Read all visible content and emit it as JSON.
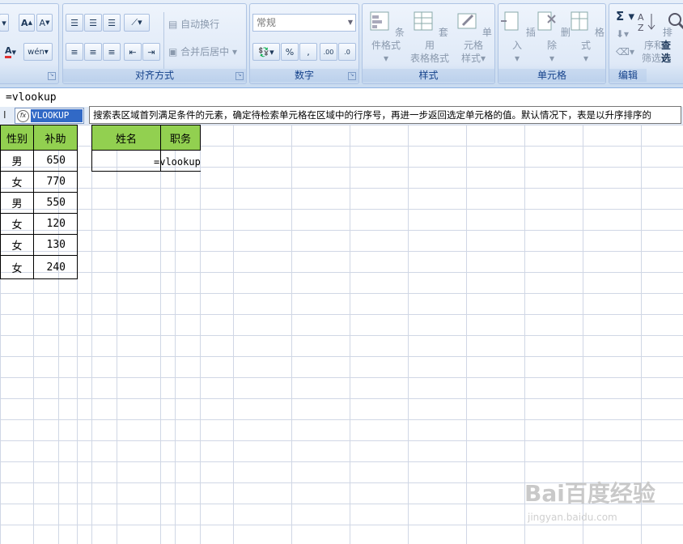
{
  "ribbon": {
    "groups": {
      "alignment": "对齐方式",
      "number": "数字",
      "styles": "样式",
      "cells": "单元格",
      "editing": "编辑"
    },
    "wrap_text": "自动换行",
    "merge_center": "合并后居中",
    "number_format": "常规",
    "conditional_format": "条件格式",
    "table_format_1": "套用",
    "table_format_2": "表格格式",
    "cell_style_1": "单元格",
    "cell_style_2": "样式",
    "insert": "插入",
    "delete": "删除",
    "format": "格式",
    "sort_filter_1": "排序和",
    "sort_filter_2": "筛选",
    "find_select_1": "查",
    "find_select_2": "选"
  },
  "formula_bar": {
    "content": "=vlookup"
  },
  "row_marker": "I",
  "autocomplete": {
    "item": "VLOOKUP",
    "tooltip": "搜索表区域首列满足条件的元素，确定待检索单元格在区域中的行序号，再进一步返回选定单元格的值。默认情况下，表是以升序排序的"
  },
  "table1": {
    "headers": [
      "性别",
      "补助"
    ],
    "rows": [
      [
        "男",
        "650"
      ],
      [
        "女",
        "770"
      ],
      [
        "男",
        "550"
      ],
      [
        "女",
        "120"
      ],
      [
        "女",
        "130"
      ],
      [
        "女",
        "240"
      ]
    ]
  },
  "table2": {
    "headers": [
      "姓名",
      "职务"
    ],
    "editing_text": "=vlookup"
  },
  "watermark": {
    "main": "Bai百度经验",
    "sub": "jingyan.baidu.com"
  },
  "colors": {
    "header_green": "#92d050",
    "selection_blue": "#3169c6",
    "ribbon_blue": "#dfe9f7"
  }
}
